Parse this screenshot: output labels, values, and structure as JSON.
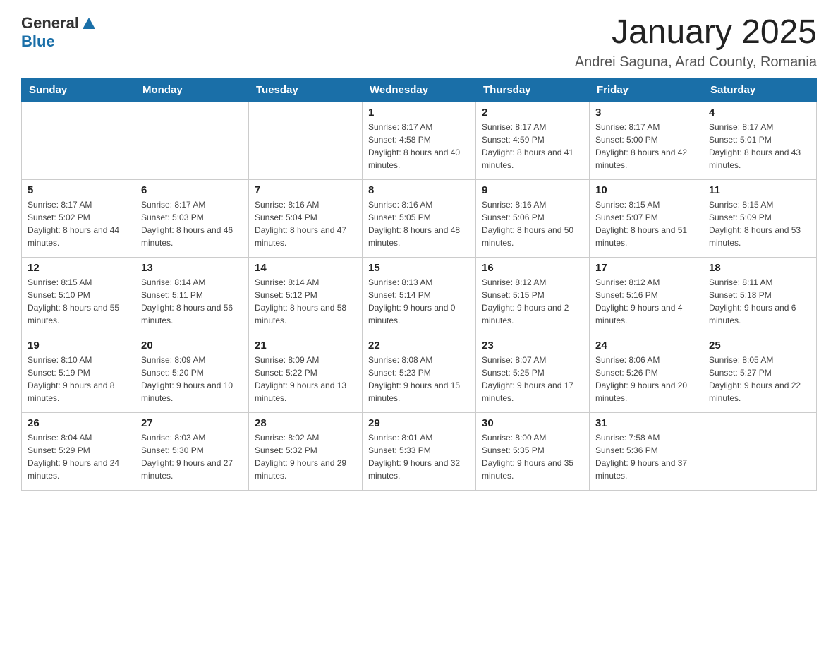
{
  "header": {
    "logo": {
      "text_general": "General",
      "text_blue": "Blue"
    },
    "title": "January 2025",
    "subtitle": "Andrei Saguna, Arad County, Romania"
  },
  "weekdays": [
    "Sunday",
    "Monday",
    "Tuesday",
    "Wednesday",
    "Thursday",
    "Friday",
    "Saturday"
  ],
  "weeks": [
    [
      {
        "day": "",
        "info": ""
      },
      {
        "day": "",
        "info": ""
      },
      {
        "day": "",
        "info": ""
      },
      {
        "day": "1",
        "info": "Sunrise: 8:17 AM\nSunset: 4:58 PM\nDaylight: 8 hours and 40 minutes."
      },
      {
        "day": "2",
        "info": "Sunrise: 8:17 AM\nSunset: 4:59 PM\nDaylight: 8 hours and 41 minutes."
      },
      {
        "day": "3",
        "info": "Sunrise: 8:17 AM\nSunset: 5:00 PM\nDaylight: 8 hours and 42 minutes."
      },
      {
        "day": "4",
        "info": "Sunrise: 8:17 AM\nSunset: 5:01 PM\nDaylight: 8 hours and 43 minutes."
      }
    ],
    [
      {
        "day": "5",
        "info": "Sunrise: 8:17 AM\nSunset: 5:02 PM\nDaylight: 8 hours and 44 minutes."
      },
      {
        "day": "6",
        "info": "Sunrise: 8:17 AM\nSunset: 5:03 PM\nDaylight: 8 hours and 46 minutes."
      },
      {
        "day": "7",
        "info": "Sunrise: 8:16 AM\nSunset: 5:04 PM\nDaylight: 8 hours and 47 minutes."
      },
      {
        "day": "8",
        "info": "Sunrise: 8:16 AM\nSunset: 5:05 PM\nDaylight: 8 hours and 48 minutes."
      },
      {
        "day": "9",
        "info": "Sunrise: 8:16 AM\nSunset: 5:06 PM\nDaylight: 8 hours and 50 minutes."
      },
      {
        "day": "10",
        "info": "Sunrise: 8:15 AM\nSunset: 5:07 PM\nDaylight: 8 hours and 51 minutes."
      },
      {
        "day": "11",
        "info": "Sunrise: 8:15 AM\nSunset: 5:09 PM\nDaylight: 8 hours and 53 minutes."
      }
    ],
    [
      {
        "day": "12",
        "info": "Sunrise: 8:15 AM\nSunset: 5:10 PM\nDaylight: 8 hours and 55 minutes."
      },
      {
        "day": "13",
        "info": "Sunrise: 8:14 AM\nSunset: 5:11 PM\nDaylight: 8 hours and 56 minutes."
      },
      {
        "day": "14",
        "info": "Sunrise: 8:14 AM\nSunset: 5:12 PM\nDaylight: 8 hours and 58 minutes."
      },
      {
        "day": "15",
        "info": "Sunrise: 8:13 AM\nSunset: 5:14 PM\nDaylight: 9 hours and 0 minutes."
      },
      {
        "day": "16",
        "info": "Sunrise: 8:12 AM\nSunset: 5:15 PM\nDaylight: 9 hours and 2 minutes."
      },
      {
        "day": "17",
        "info": "Sunrise: 8:12 AM\nSunset: 5:16 PM\nDaylight: 9 hours and 4 minutes."
      },
      {
        "day": "18",
        "info": "Sunrise: 8:11 AM\nSunset: 5:18 PM\nDaylight: 9 hours and 6 minutes."
      }
    ],
    [
      {
        "day": "19",
        "info": "Sunrise: 8:10 AM\nSunset: 5:19 PM\nDaylight: 9 hours and 8 minutes."
      },
      {
        "day": "20",
        "info": "Sunrise: 8:09 AM\nSunset: 5:20 PM\nDaylight: 9 hours and 10 minutes."
      },
      {
        "day": "21",
        "info": "Sunrise: 8:09 AM\nSunset: 5:22 PM\nDaylight: 9 hours and 13 minutes."
      },
      {
        "day": "22",
        "info": "Sunrise: 8:08 AM\nSunset: 5:23 PM\nDaylight: 9 hours and 15 minutes."
      },
      {
        "day": "23",
        "info": "Sunrise: 8:07 AM\nSunset: 5:25 PM\nDaylight: 9 hours and 17 minutes."
      },
      {
        "day": "24",
        "info": "Sunrise: 8:06 AM\nSunset: 5:26 PM\nDaylight: 9 hours and 20 minutes."
      },
      {
        "day": "25",
        "info": "Sunrise: 8:05 AM\nSunset: 5:27 PM\nDaylight: 9 hours and 22 minutes."
      }
    ],
    [
      {
        "day": "26",
        "info": "Sunrise: 8:04 AM\nSunset: 5:29 PM\nDaylight: 9 hours and 24 minutes."
      },
      {
        "day": "27",
        "info": "Sunrise: 8:03 AM\nSunset: 5:30 PM\nDaylight: 9 hours and 27 minutes."
      },
      {
        "day": "28",
        "info": "Sunrise: 8:02 AM\nSunset: 5:32 PM\nDaylight: 9 hours and 29 minutes."
      },
      {
        "day": "29",
        "info": "Sunrise: 8:01 AM\nSunset: 5:33 PM\nDaylight: 9 hours and 32 minutes."
      },
      {
        "day": "30",
        "info": "Sunrise: 8:00 AM\nSunset: 5:35 PM\nDaylight: 9 hours and 35 minutes."
      },
      {
        "day": "31",
        "info": "Sunrise: 7:58 AM\nSunset: 5:36 PM\nDaylight: 9 hours and 37 minutes."
      },
      {
        "day": "",
        "info": ""
      }
    ]
  ]
}
